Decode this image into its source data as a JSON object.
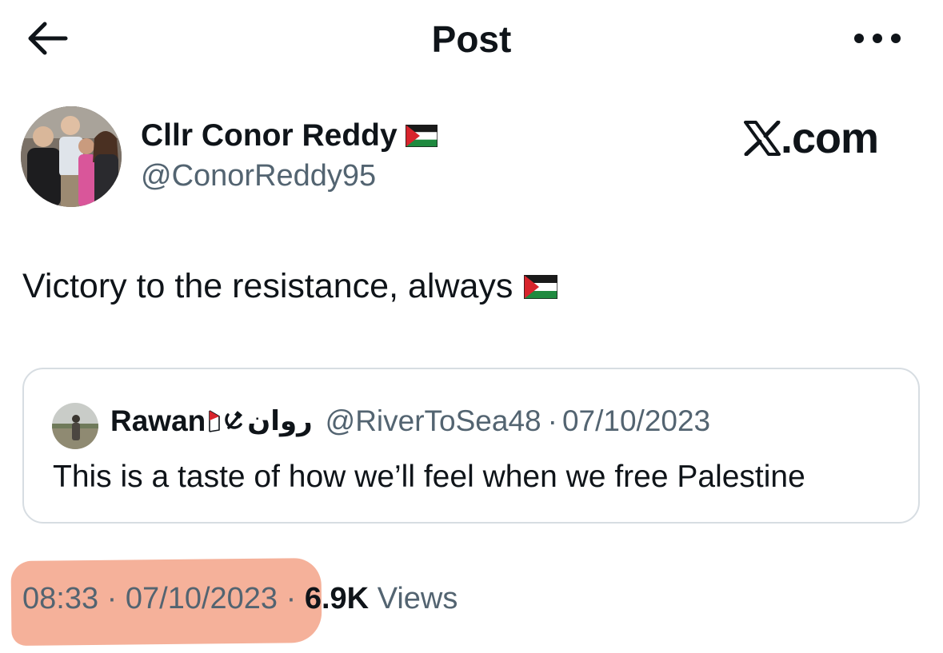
{
  "header": {
    "title": "Post",
    "back_icon": "arrow-left-icon",
    "more_icon": "more-horizontal-icon"
  },
  "author": {
    "display_name": "Cllr Conor Reddy",
    "handle": "@ConorReddy95",
    "flag_icon": "palestine-flag-icon"
  },
  "watermark": {
    "text": ".com",
    "icon": "x-logo-icon"
  },
  "post": {
    "text": "Victory to the resistance, always"
  },
  "quoted_post": {
    "name": "Rawan",
    "arabic_name": "روان",
    "handle": "@RiverToSea48",
    "separator": "·",
    "date": "07/10/2023",
    "text": "This is a taste of how we’ll feel when we free Palestine"
  },
  "meta": {
    "time": "08:33",
    "separator": "·",
    "date": "07/10/2023",
    "views_count": "6.9K",
    "views_label": "Views"
  },
  "colors": {
    "text_primary": "#0f1419",
    "text_secondary": "#536471",
    "border": "#d7dde2",
    "highlight": "#f4a88f"
  }
}
